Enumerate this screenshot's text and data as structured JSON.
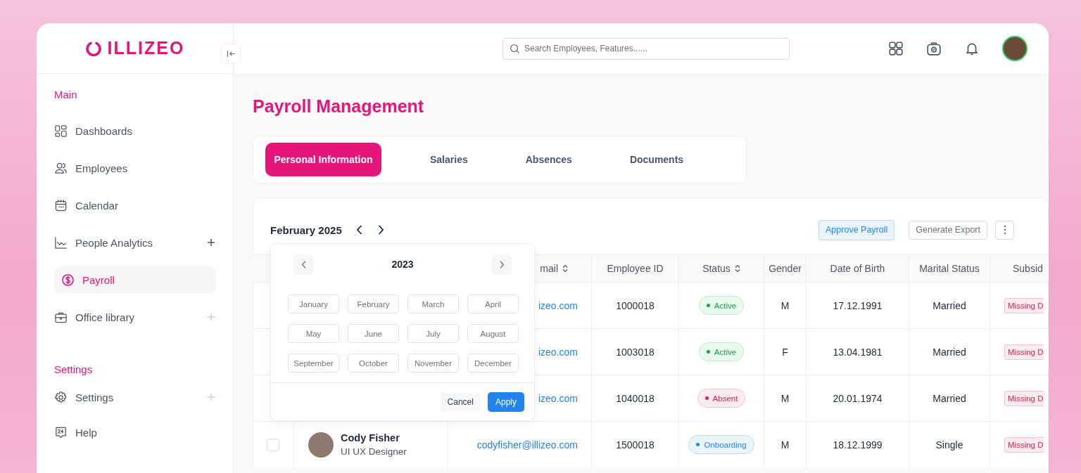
{
  "logo": {
    "text": "ILLIZEO"
  },
  "sidebar": {
    "sections": [
      {
        "title": "Main",
        "items": [
          {
            "label": "Dashboards",
            "selected": false,
            "expandable": false
          },
          {
            "label": "Employees",
            "selected": false,
            "expandable": false
          },
          {
            "label": "Calendar",
            "selected": false,
            "expandable": false
          },
          {
            "label": "People Analytics",
            "selected": false,
            "expandable": true
          },
          {
            "label": "Payroll",
            "selected": true,
            "expandable": false
          },
          {
            "label": "Office library",
            "selected": false,
            "expandable": true
          }
        ]
      },
      {
        "title": "Settings",
        "items": [
          {
            "label": "Settings",
            "selected": false,
            "expandable": true
          },
          {
            "label": "Help",
            "selected": false,
            "expandable": false
          }
        ]
      }
    ]
  },
  "search": {
    "placeholder": "Search Employees, Features......"
  },
  "page_title": "Payroll Management",
  "tabs": [
    {
      "label": "Personal Information",
      "selected": true
    },
    {
      "label": "Salaries",
      "selected": false
    },
    {
      "label": "Absences",
      "selected": false
    },
    {
      "label": "Documents",
      "selected": false
    }
  ],
  "period": {
    "label": "February 2025"
  },
  "actions": {
    "approve": "Approve Payroll",
    "export": "Generate Export"
  },
  "month_picker": {
    "year": "2023",
    "months": [
      {
        "label": "January",
        "selected": false
      },
      {
        "label": "February",
        "selected": false
      },
      {
        "label": "March",
        "selected": false
      },
      {
        "label": "April",
        "selected": false
      },
      {
        "label": "May",
        "selected": false
      },
      {
        "label": "June",
        "selected": false
      },
      {
        "label": "July",
        "selected": false
      },
      {
        "label": "August",
        "selected": false
      },
      {
        "label": "September",
        "selected": false
      },
      {
        "label": "October",
        "selected": false
      },
      {
        "label": "November",
        "selected": false
      },
      {
        "label": "December",
        "selected": false
      }
    ],
    "cancel": "Cancel",
    "apply": "Apply"
  },
  "table": {
    "columns": [
      {
        "label": "mail",
        "sortable": true
      },
      {
        "label": "Employee ID",
        "sortable": false
      },
      {
        "label": "Status",
        "sortable": true
      },
      {
        "label": "Gender",
        "sortable": false
      },
      {
        "label": "Date of Birth",
        "sortable": false
      },
      {
        "label": "Marital Status",
        "sortable": false
      },
      {
        "label": "Subsid",
        "sortable": false
      }
    ],
    "rows": [
      {
        "email": "izeo.com",
        "employee_id": "1000018",
        "status": {
          "label": "Active",
          "kind": "active"
        },
        "gender": "M",
        "date_of_birth": "17.12.1991",
        "marital_status": "Married",
        "subsidy": "Missing D"
      },
      {
        "email": "izeo.com",
        "employee_id": "1003018",
        "status": {
          "label": "Active",
          "kind": "active"
        },
        "gender": "F",
        "date_of_birth": "13.04.1981",
        "marital_status": "Married",
        "subsidy": "Missing D"
      },
      {
        "email": "izeo.com",
        "employee_id": "1040018",
        "status": {
          "label": "Absent",
          "kind": "absent"
        },
        "gender": "M",
        "date_of_birth": "20.01.1974",
        "marital_status": "Married",
        "subsidy": "Missing D"
      },
      {
        "checked": false,
        "name": "Cody Fisher",
        "role": "UI UX Designer",
        "email": "codyfisher@illizeo.com",
        "employee_id": "1500018",
        "status": {
          "label": "Onboarding",
          "kind": "onboarding"
        },
        "gender": "M",
        "date_of_birth": "18.12.1999",
        "marital_status": "Single",
        "subsidy": "Missing D"
      }
    ]
  }
}
